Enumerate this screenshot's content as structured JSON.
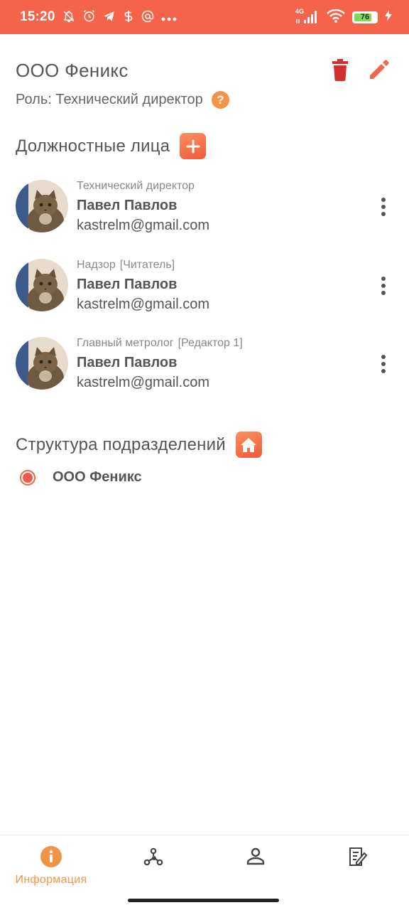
{
  "status_bar": {
    "time": "15:20",
    "network": "4G",
    "battery_level": "76",
    "background_color": "#f4634a"
  },
  "header": {
    "title": "ООО Феникс",
    "delete_icon": "trash-icon",
    "edit_icon": "pencil-icon"
  },
  "role": {
    "text": "Роль: Технический директор",
    "help_symbol": "?"
  },
  "officials": {
    "title": "Должностные лица",
    "add_icon": "plus-icon",
    "items": [
      {
        "position": "Технический директор",
        "access": "",
        "name": "Павел Павлов",
        "email": "kastrelm@gmail.com"
      },
      {
        "position": "Надзор",
        "access": "[Читатель]",
        "name": "Павел Павлов",
        "email": "kastrelm@gmail.com"
      },
      {
        "position": "Главный метролог",
        "access": "[Редактор 1]",
        "name": "Павел Павлов",
        "email": "kastrelm@gmail.com"
      }
    ]
  },
  "structure": {
    "title": "Структура подразделений",
    "home_icon": "home-icon",
    "items": [
      {
        "label": "ООО Феникс",
        "selected": true
      }
    ]
  },
  "bottom_nav": {
    "items": [
      {
        "label": "Информация",
        "icon": "info-icon",
        "active": true
      },
      {
        "label": "",
        "icon": "network-icon",
        "active": false
      },
      {
        "label": "",
        "icon": "person-icon",
        "active": false
      },
      {
        "label": "",
        "icon": "document-edit-icon",
        "active": false
      }
    ]
  },
  "colors": {
    "accent": "#f4634a",
    "accent_orange": "#f29447",
    "danger": "#d32f2f",
    "text": "#555555"
  }
}
